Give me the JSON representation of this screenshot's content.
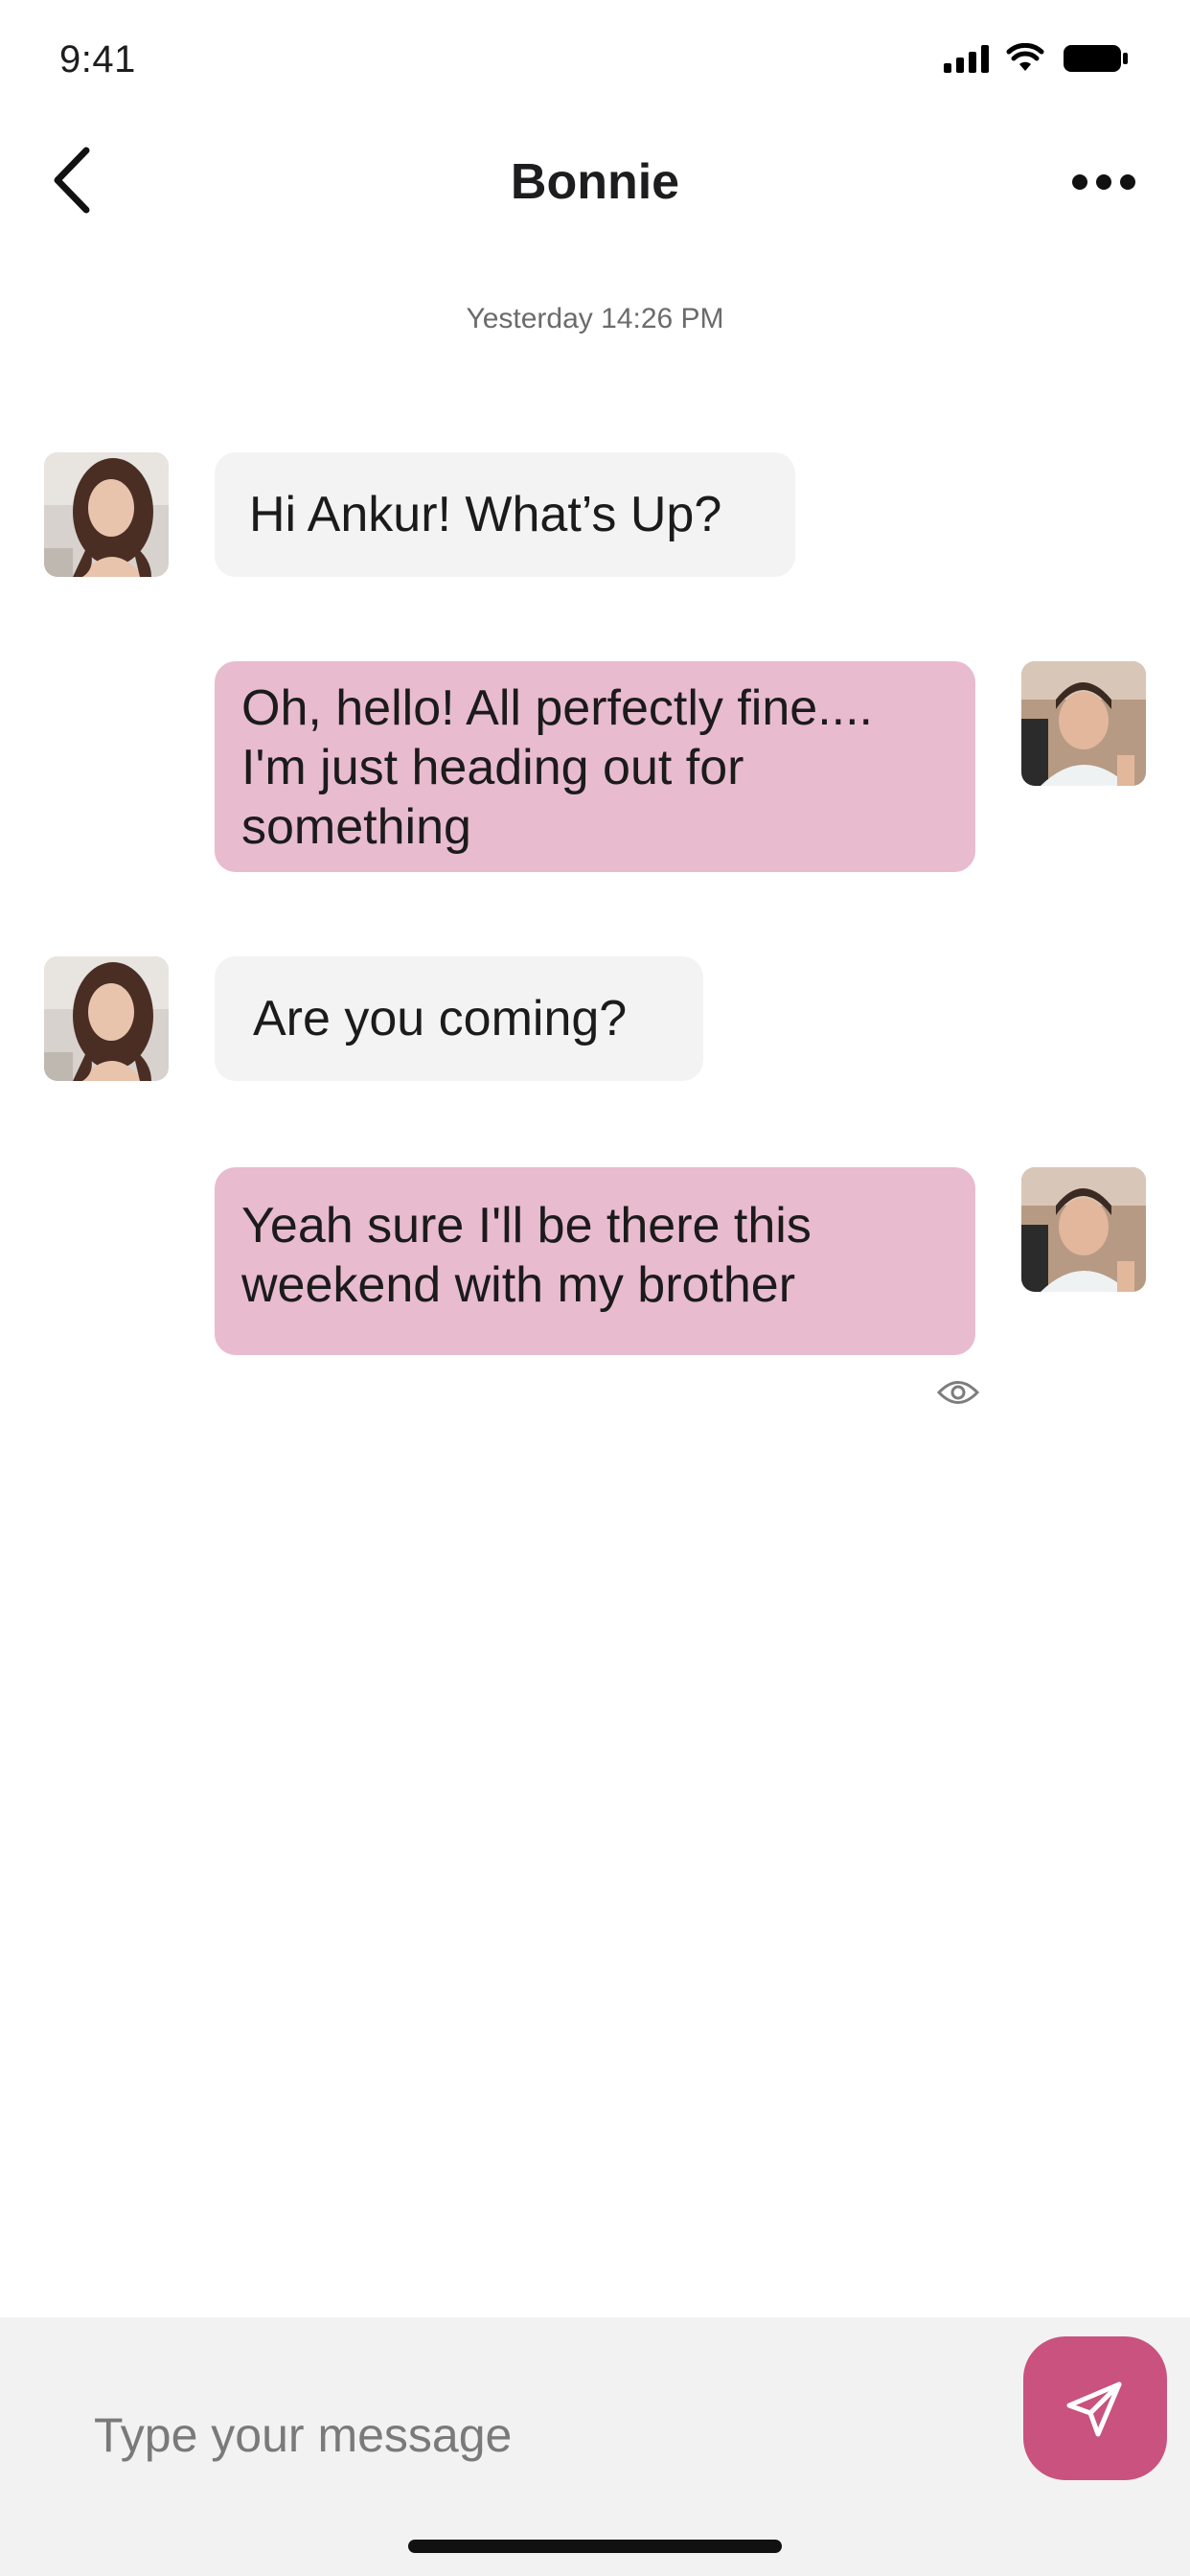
{
  "status_bar": {
    "time": "9:41",
    "icons": [
      "cellular-signal-icon",
      "wifi-icon",
      "battery-icon"
    ]
  },
  "header": {
    "title": "Bonnie",
    "back_icon": "chevron-left-icon",
    "more_icon": "more-horizontal-icon"
  },
  "conversation": {
    "timestamp": "Yesterday 14:26 PM",
    "messages": [
      {
        "sender": "Bonnie",
        "direction": "incoming",
        "text": "Hi Ankur! What’s Up?"
      },
      {
        "sender": "Ankur",
        "direction": "outgoing",
        "text": "Oh, hello! All perfectly fine.... I'm just heading out for something"
      },
      {
        "sender": "Bonnie",
        "direction": "incoming",
        "text": "Are you coming?"
      },
      {
        "sender": "Ankur",
        "direction": "outgoing",
        "text": "Yeah sure I'll be there this weekend with my brother"
      }
    ],
    "seen_icon": "eye-icon"
  },
  "composer": {
    "placeholder": "Type your message",
    "value": "",
    "send_icon": "send-icon"
  },
  "colors": {
    "incoming_bubble": "#f3f3f3",
    "outgoing_bubble": "#e9bbcf",
    "accent": "#c9527f",
    "composer_background": "#f2f2f2"
  }
}
